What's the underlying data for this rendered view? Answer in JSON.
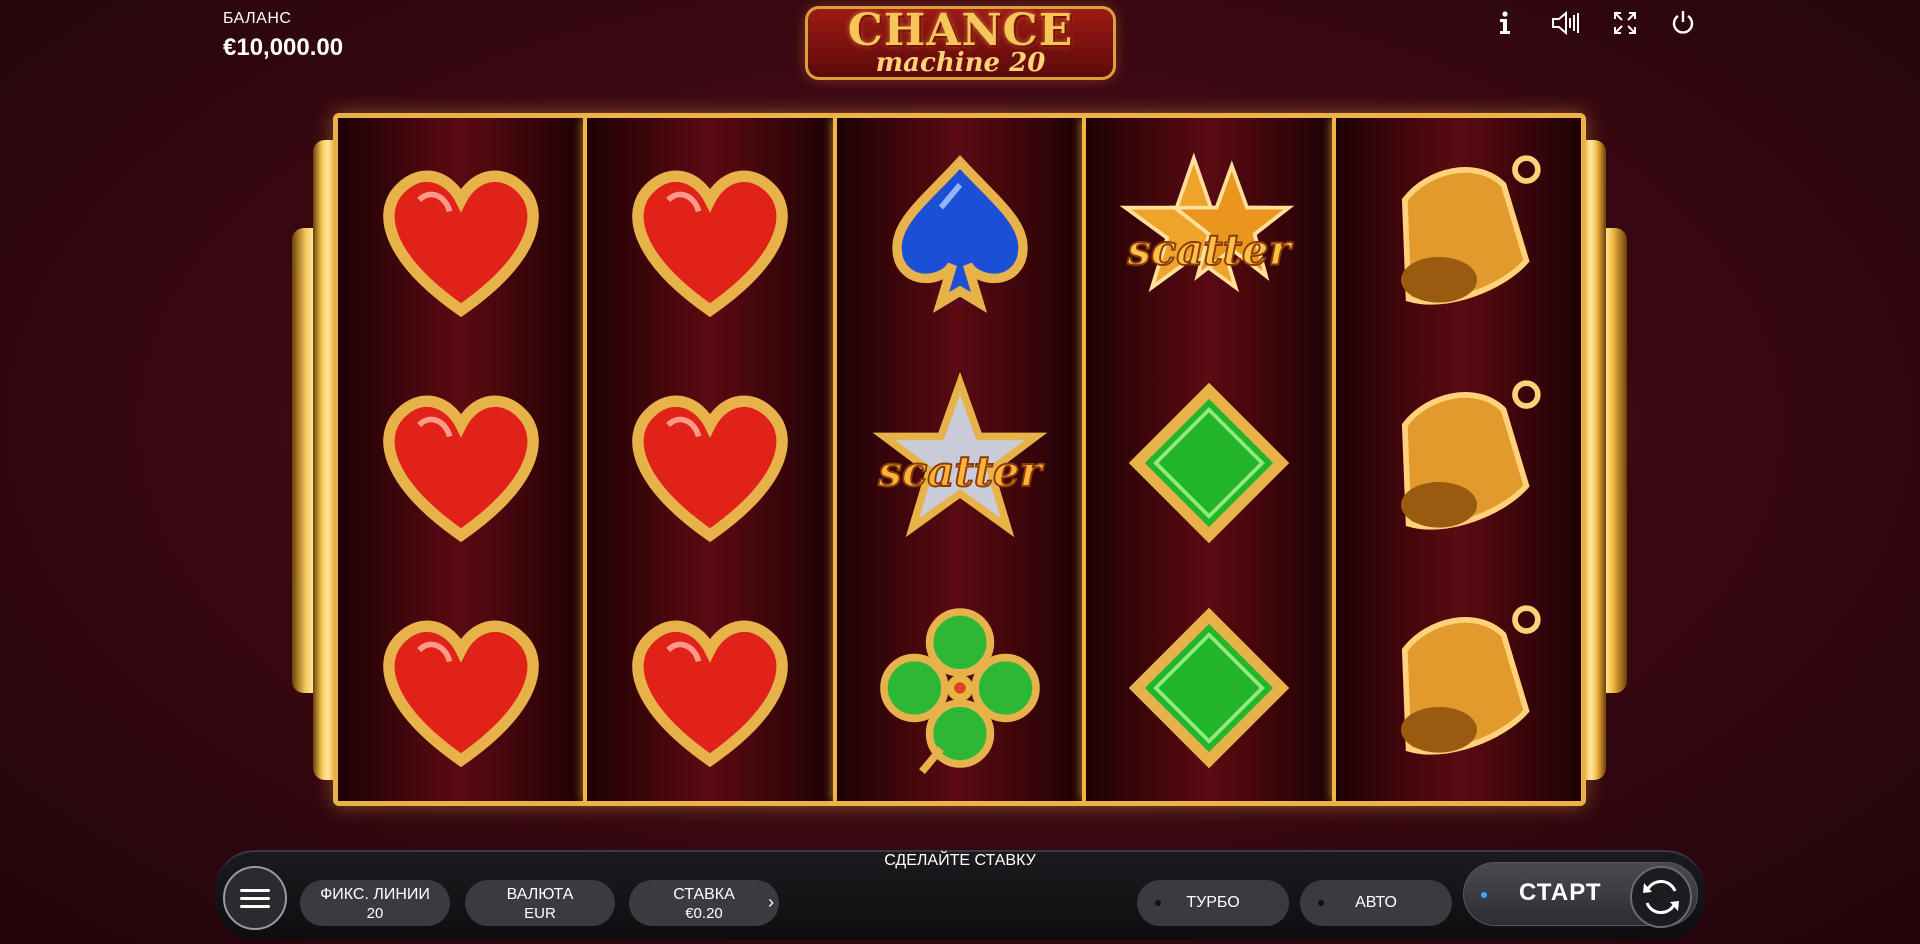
{
  "balance": {
    "label": "БАЛАНС",
    "value": "€10,000.00"
  },
  "logo": {
    "line1": "CHANCE",
    "line2": "machine 20"
  },
  "top_icons": [
    "info-icon",
    "sound-icon",
    "fullscreen-icon",
    "power-icon"
  ],
  "reels": [
    [
      "red-heart",
      "red-heart",
      "red-heart"
    ],
    [
      "red-heart",
      "red-heart",
      "red-heart"
    ],
    [
      "blue-spade",
      "silver-star-scatter",
      "green-clover"
    ],
    [
      "gold-star-scatter",
      "green-diamond",
      "green-diamond"
    ],
    [
      "gold-bell",
      "gold-bell",
      "gold-bell"
    ]
  ],
  "scatter_label": "scatter",
  "prompt": "СДЕЛАЙТЕ СТАВКУ",
  "controls": {
    "lines_label": "ФИКС. ЛИНИИ",
    "lines_value": "20",
    "currency_label": "ВАЛЮТА",
    "currency_value": "EUR",
    "bet_label": "СТАВКА",
    "bet_value": "€0.20",
    "turbo_label": "ТУРБО",
    "auto_label": "АВТО",
    "start_label": "СТАРТ"
  },
  "colors": {
    "background": "#3d0914",
    "gold": "#e8b24a",
    "start_led": "#36a8ff"
  }
}
